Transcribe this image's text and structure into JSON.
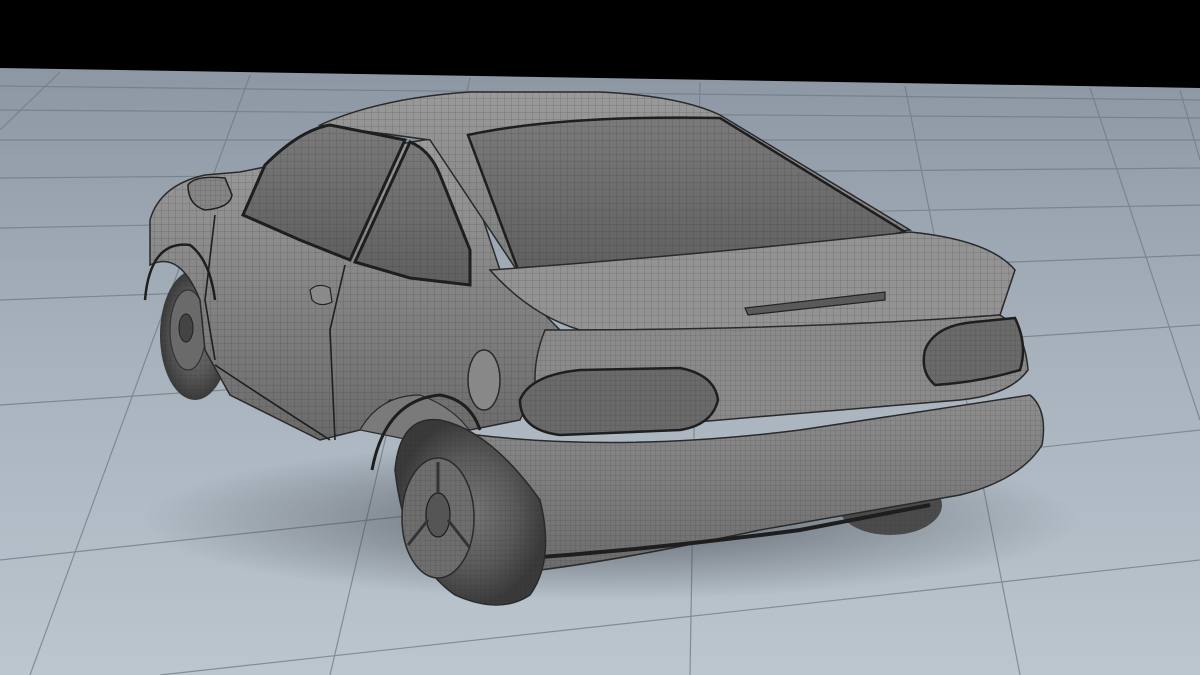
{
  "scene": {
    "subject": "car-wireframe-render",
    "colors": {
      "background_top": "#000000",
      "floor_far": "#8f9aa6",
      "floor_near": "#b9c4ce",
      "floor_grid": "#6c7782",
      "car_body": "#7f7f7f",
      "car_body_light": "#9a9a9a",
      "car_body_dark": "#555555",
      "glass": "#6b6b6b",
      "mesh_line": "#2b2b2b",
      "tyre": "#4a4a4a"
    }
  }
}
